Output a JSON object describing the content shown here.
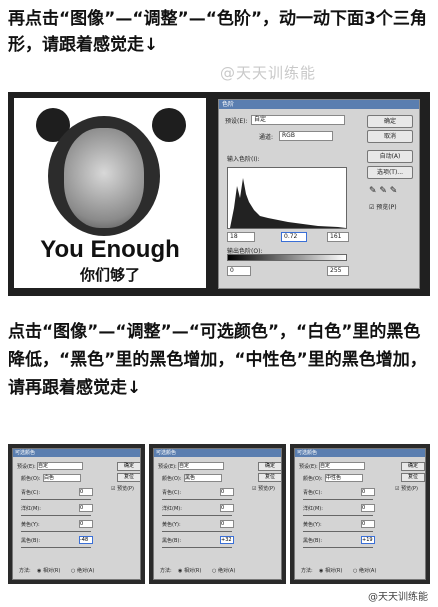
{
  "intro_text": "再点击“图像”—“调整”—“色阶”，动一动下面3个三角形，请跟着感觉走↓",
  "watermark": "@天天训练能",
  "meme": {
    "caption_en": "You Enough",
    "caption_zh": "你们够了"
  },
  "levels_dialog": {
    "title": "色阶",
    "preset_label": "预设(E):",
    "preset_value": "自定",
    "channel_label": "通道:",
    "channel_value": "RGB",
    "input_levels_label": "输入色阶(I):",
    "input_values": [
      "18",
      "0.72",
      "161"
    ],
    "output_levels_label": "输出色阶(O):",
    "output_values": [
      "0",
      "255"
    ],
    "buttons": [
      "确定",
      "取消",
      "自动(A)",
      "选项(T)..."
    ],
    "preview_label": "预览(P)"
  },
  "intro2_text": "点击“图像”—“调整”—“可选颜色”，“白色”里的黑色降低，“黑色”里的黑色增加，“中性色”里的黑色增加，请再跟着感觉走↓",
  "selective_color_panels": [
    {
      "title": "可选颜色",
      "preset_label": "预设(E):",
      "preset_value": "自定",
      "colors_label": "颜色(O):",
      "colors_value": "白色",
      "rows": [
        {
          "label": "青色(C):",
          "value": "0"
        },
        {
          "label": "洋红(M):",
          "value": "0"
        },
        {
          "label": "黄色(Y):",
          "value": "0"
        },
        {
          "label": "黑色(B):",
          "value": "-48"
        }
      ],
      "method_label": "方法:",
      "relative": "相对(R)",
      "absolute": "绝对(A)"
    },
    {
      "title": "可选颜色",
      "preset_label": "预设(E):",
      "preset_value": "自定",
      "colors_label": "颜色(O):",
      "colors_value": "黑色",
      "rows": [
        {
          "label": "青色(C):",
          "value": "0"
        },
        {
          "label": "洋红(M):",
          "value": "0"
        },
        {
          "label": "黄色(Y):",
          "value": "0"
        },
        {
          "label": "黑色(B):",
          "value": "+32"
        }
      ],
      "method_label": "方法:",
      "relative": "相对(R)",
      "absolute": "绝对(A)"
    },
    {
      "title": "可选颜色",
      "preset_label": "预设(E):",
      "preset_value": "自定",
      "colors_label": "颜色(O):",
      "colors_value": "中性色",
      "rows": [
        {
          "label": "青色(C):",
          "value": "0"
        },
        {
          "label": "洋红(M):",
          "value": "0"
        },
        {
          "label": "黄色(Y):",
          "value": "0"
        },
        {
          "label": "黑色(B):",
          "value": "+19"
        }
      ],
      "method_label": "方法:",
      "relative": "相对(R)",
      "absolute": "绝对(A)"
    }
  ],
  "selective_color_buttons": [
    "确定",
    "复位",
    "预览(P)"
  ],
  "footer": "@天天训练能"
}
